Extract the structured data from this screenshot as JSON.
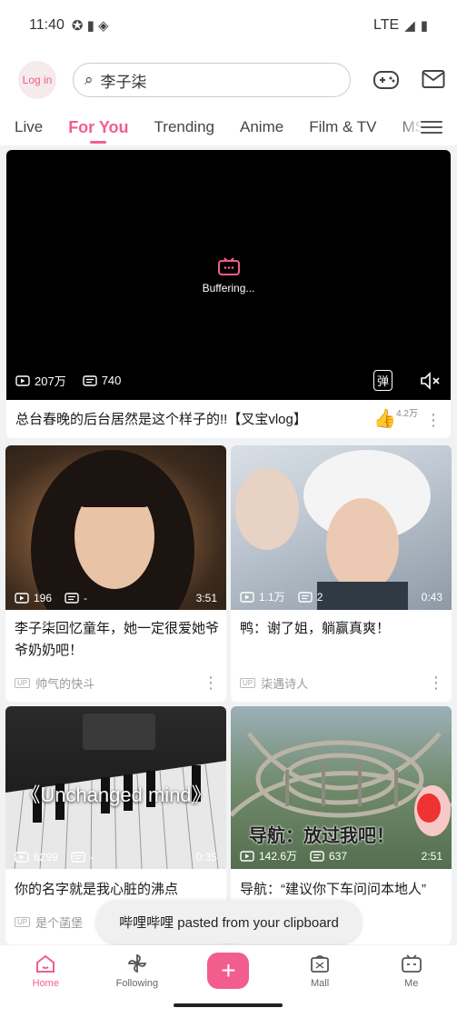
{
  "status_bar": {
    "time": "11:40",
    "network": "LTE"
  },
  "header": {
    "login_label": "Log in",
    "search_value": "李子柒"
  },
  "tabs": [
    "Live",
    "For You",
    "Trending",
    "Anime",
    "Film & TV",
    "MSI"
  ],
  "active_tab": "For You",
  "featured": {
    "buffering_text": "Buffering...",
    "views": "207万",
    "danmaku": "740",
    "danmaku_toggle": "弹",
    "title": "总台春晚的后台居然是这个样子的!!【叉宝vlog】",
    "likes": "4.2万"
  },
  "cards": [
    {
      "views": "196",
      "comments": "-",
      "duration": "3:51",
      "title": "李子柒回忆童年，她一定很爱她爷爷奶奶吧！",
      "uploader": "帅气的快斗",
      "up_badge": "UP"
    },
    {
      "views": "1.1万",
      "comments": "2",
      "duration": "0:43",
      "title": "鸭：谢了姐，躺赢真爽！",
      "uploader": "柒遇诗人",
      "up_badge": "UP"
    },
    {
      "views": "6299",
      "comments": "-",
      "duration": "0:35",
      "title": "你的名字就是我心脏的沸点",
      "uploader": "是个菡堡",
      "up_badge": "UP",
      "overlay_text": "《Unchanged mind》"
    },
    {
      "views": "142.6万",
      "comments": "637",
      "duration": "2:51",
      "title": "导航：“建议你下车问问本地人”",
      "uploader": "",
      "up_badge": "UP",
      "overlay_text": "导航：放过我吧！"
    }
  ],
  "toast": "哔哩哔哩 pasted from your clipboard",
  "bottom_nav": {
    "home": "Home",
    "following": "Following",
    "plus": "+",
    "mall": "Mall",
    "me": "Me"
  },
  "colors": {
    "accent": "#f25d8e",
    "background": "#f1f2f3"
  }
}
